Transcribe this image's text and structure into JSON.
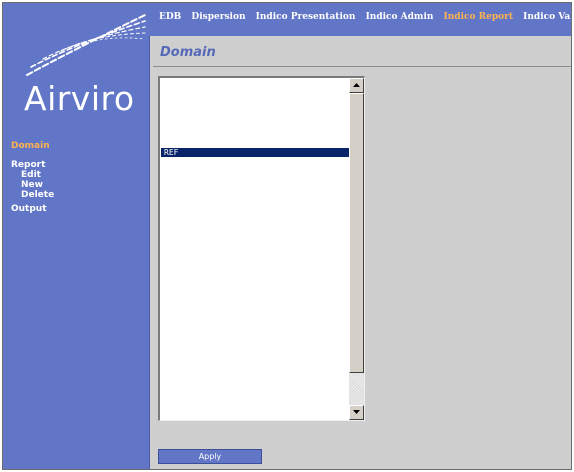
{
  "brand": {
    "logo_text": "Airviro"
  },
  "topnav": {
    "items": [
      {
        "label": "EDB",
        "active": false
      },
      {
        "label": "Dispersion",
        "active": false
      },
      {
        "label": "Indico Presentation",
        "active": false
      },
      {
        "label": "Indico Admin",
        "active": false
      },
      {
        "label": "Indico Report",
        "active": true
      },
      {
        "label": "Indico Validation",
        "active": false
      }
    ]
  },
  "sidebar": {
    "items": [
      {
        "label": "Domain",
        "active": true
      },
      {
        "label": "Report",
        "active": false
      },
      {
        "label": "Edit",
        "active": false
      },
      {
        "label": "New",
        "active": false
      },
      {
        "label": "Delete",
        "active": false
      },
      {
        "label": "Output",
        "active": false
      }
    ]
  },
  "page": {
    "title": "Domain"
  },
  "domain_list": {
    "items": [
      "REF"
    ],
    "selected": "REF"
  },
  "actions": {
    "apply_label": "Apply"
  },
  "colors": {
    "nav_bg": "#6176c6",
    "active_link": "#ffb24f",
    "selection": "#0a246a",
    "title": "#5569b8"
  }
}
